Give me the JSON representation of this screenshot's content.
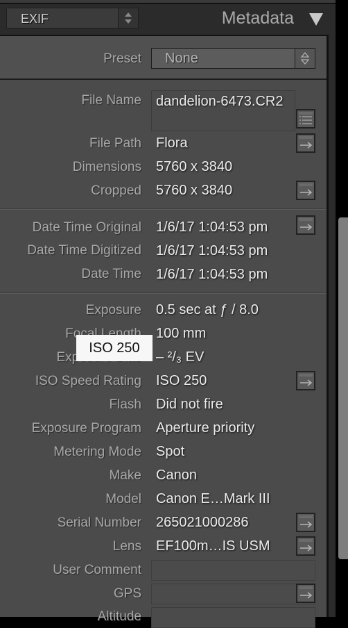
{
  "header": {
    "view_select": "EXIF",
    "panel_title": "Metadata"
  },
  "preset": {
    "label": "Preset",
    "value": "None"
  },
  "file": {
    "file_name_label": "File Name",
    "file_name": "dandelion-6473.CR2",
    "file_path_label": "File Path",
    "file_path": "Flora",
    "dimensions_label": "Dimensions",
    "dimensions": "5760 x 3840",
    "cropped_label": "Cropped",
    "cropped": "5760 x 3840"
  },
  "dates": {
    "original_label": "Date Time Original",
    "original": "1/6/17 1:04:53 pm",
    "digitized_label": "Date Time Digitized",
    "digitized": "1/6/17 1:04:53 pm",
    "datetime_label": "Date Time",
    "datetime": "1/6/17 1:04:53 pm"
  },
  "camera": {
    "exposure_label": "Exposure",
    "exposure": "0.5 sec at ƒ / 8.0",
    "focal_label": "Focal Length",
    "focal": "100 mm",
    "bias_label": "Exposure Bias",
    "bias": "– ²/₃ EV",
    "iso_label": "ISO Speed Rating",
    "iso": "ISO 250",
    "flash_label": "Flash",
    "flash": "Did not fire",
    "program_label": "Exposure Program",
    "program": "Aperture priority",
    "metering_label": "Metering Mode",
    "metering": "Spot",
    "make_label": "Make",
    "make": "Canon",
    "model_label": "Model",
    "model": "Canon E…Mark III",
    "serial_label": "Serial Number",
    "serial": "265021000286",
    "lens_label": "Lens",
    "lens": "EF100m…IS USM",
    "comment_label": "User Comment",
    "comment": "",
    "gps_label": "GPS",
    "gps": "",
    "altitude_label": "Altitude"
  },
  "tooltip": {
    "text": "ISO 250"
  }
}
